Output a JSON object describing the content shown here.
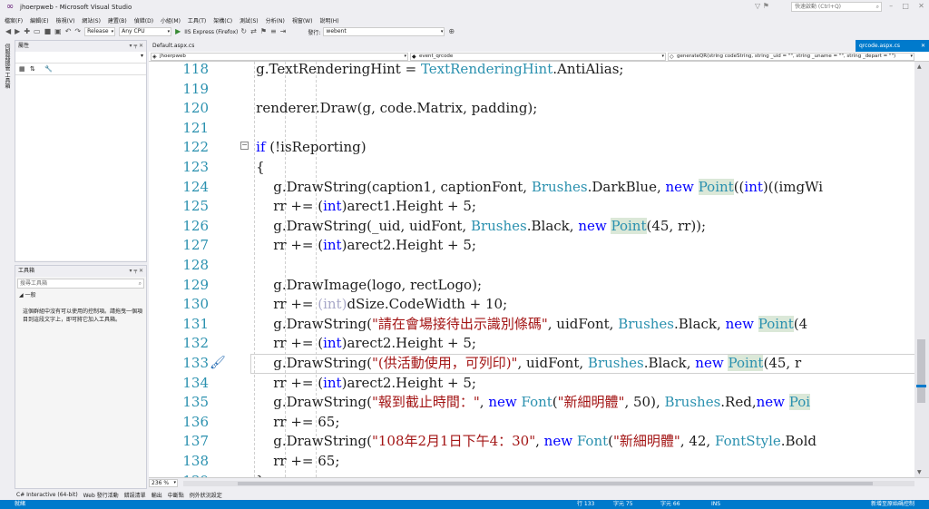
{
  "window": {
    "title": "jhoerpweb - Microsoft Visual Studio",
    "logo_icon": "visual-studio-logo-icon",
    "quick_launch_placeholder": "快速啟動 (Ctrl+Q)"
  },
  "menu": [
    "檔案(F)",
    "編輯(E)",
    "檢視(V)",
    "網站(S)",
    "建置(B)",
    "偵錯(D)",
    "小組(M)",
    "工具(T)",
    "架構(C)",
    "測試(S)",
    "分析(N)",
    "視窗(W)",
    "說明(H)"
  ],
  "toolbar": {
    "configuration": "Release",
    "platform": "Any CPU",
    "run_target": "IIS Express (Firefox)",
    "publish_label": "發行:",
    "publish_target": "webent"
  },
  "left_strip": {
    "label": "伺服器總管 工具箱"
  },
  "properties_panel": {
    "title": "屬性",
    "pin": "▾ ╤ ✕"
  },
  "toolbox_panel": {
    "title": "工具箱",
    "pin": "▾ ╤ ✕",
    "search_placeholder": "搜尋工具箱",
    "group": "◢ 一般",
    "message": "這個群組中沒有可以使用的控制項。請拖曳一個項目到這段文字上，即可將它加入工具箱。"
  },
  "tabs": {
    "left": "Default.aspx.cs",
    "active": "qrcode.aspx.cs",
    "close": "✕"
  },
  "navbar": {
    "project": "jhoerpweb",
    "class": "event_qrcode",
    "member": "generateQR(string codeString, string _uid = \"\", string _uname = \"\", string _depart = \"\")"
  },
  "editor": {
    "zoom": "236 %"
  },
  "code_lines": [
    {
      "n": "118",
      "parts": [
        {
          "t": "        g.TextRenderingHint = ",
          "c": ""
        },
        {
          "t": "TextRenderingHint",
          "c": "ty"
        },
        {
          "t": ".AntiAlias;",
          "c": ""
        }
      ]
    },
    {
      "n": "119",
      "parts": []
    },
    {
      "n": "120",
      "parts": [
        {
          "t": "        renderer.Draw(g, code.Matrix, padding);",
          "c": ""
        }
      ]
    },
    {
      "n": "121",
      "parts": []
    },
    {
      "n": "122",
      "parts": [
        {
          "t": "        ",
          "c": ""
        },
        {
          "t": "if",
          "c": "kw"
        },
        {
          "t": " (!isReporting)",
          "c": ""
        }
      ]
    },
    {
      "n": "123",
      "parts": [
        {
          "t": "        {",
          "c": ""
        }
      ]
    },
    {
      "n": "124",
      "parts": [
        {
          "t": "            g.DrawString(caption1, captionFont, ",
          "c": ""
        },
        {
          "t": "Brushes",
          "c": "ty"
        },
        {
          "t": ".DarkBlue, ",
          "c": ""
        },
        {
          "t": "new",
          "c": "kw"
        },
        {
          "t": " ",
          "c": ""
        },
        {
          "t": "Point",
          "c": "ty hl"
        },
        {
          "t": "((",
          "c": ""
        },
        {
          "t": "int",
          "c": "kw"
        },
        {
          "t": ")((imgWi",
          "c": ""
        }
      ]
    },
    {
      "n": "125",
      "parts": [
        {
          "t": "            rr += (",
          "c": ""
        },
        {
          "t": "int",
          "c": "kw"
        },
        {
          "t": ")arect1.Height + 5;",
          "c": ""
        }
      ]
    },
    {
      "n": "126",
      "parts": [
        {
          "t": "            g.DrawString(_uid, uidFont, ",
          "c": ""
        },
        {
          "t": "Brushes",
          "c": "ty"
        },
        {
          "t": ".Black, ",
          "c": ""
        },
        {
          "t": "new",
          "c": "kw"
        },
        {
          "t": " ",
          "c": ""
        },
        {
          "t": "Point",
          "c": "ty hl"
        },
        {
          "t": "(45, rr));",
          "c": ""
        }
      ]
    },
    {
      "n": "127",
      "parts": [
        {
          "t": "            rr += (",
          "c": ""
        },
        {
          "t": "int",
          "c": "kw"
        },
        {
          "t": ")arect2.Height + 5;",
          "c": ""
        }
      ]
    },
    {
      "n": "128",
      "parts": []
    },
    {
      "n": "129",
      "parts": [
        {
          "t": "            g.DrawImage(logo, rectLogo);",
          "c": ""
        }
      ]
    },
    {
      "n": "130",
      "parts": [
        {
          "t": "            rr += ",
          "c": ""
        },
        {
          "t": "(int)",
          "c": "gr"
        },
        {
          "t": "dSize.CodeWidth + 10;",
          "c": ""
        }
      ]
    },
    {
      "n": "131",
      "parts": [
        {
          "t": "            g.DrawString(",
          "c": ""
        },
        {
          "t": "\"請在會場接待出示識別條碼\"",
          "c": "st"
        },
        {
          "t": ", uidFont, ",
          "c": ""
        },
        {
          "t": "Brushes",
          "c": "ty"
        },
        {
          "t": ".Black, ",
          "c": ""
        },
        {
          "t": "new",
          "c": "kw"
        },
        {
          "t": " ",
          "c": ""
        },
        {
          "t": "Point",
          "c": "ty hl"
        },
        {
          "t": "(4",
          "c": ""
        }
      ]
    },
    {
      "n": "132",
      "parts": [
        {
          "t": "            rr += (",
          "c": ""
        },
        {
          "t": "int",
          "c": "kw"
        },
        {
          "t": ")arect2.Height + 5;",
          "c": ""
        }
      ]
    },
    {
      "n": "133",
      "parts": [
        {
          "t": "            g.DrawString(",
          "c": ""
        },
        {
          "t": "\"(供活動使用，可列印)\"",
          "c": "st"
        },
        {
          "t": ", uidFont, ",
          "c": ""
        },
        {
          "t": "Brushes",
          "c": "ty"
        },
        {
          "t": ".Black, ",
          "c": ""
        },
        {
          "t": "new",
          "c": "kw"
        },
        {
          "t": " ",
          "c": ""
        },
        {
          "t": "Point",
          "c": "ty hl"
        },
        {
          "t": "(45, r",
          "c": ""
        }
      ]
    },
    {
      "n": "134",
      "parts": [
        {
          "t": "            rr += (",
          "c": ""
        },
        {
          "t": "int",
          "c": "kw"
        },
        {
          "t": ")arect2.Height + 5;",
          "c": ""
        }
      ]
    },
    {
      "n": "135",
      "parts": [
        {
          "t": "            g.DrawString(",
          "c": ""
        },
        {
          "t": "\"報到截止時間：\"",
          "c": "st"
        },
        {
          "t": ", ",
          "c": ""
        },
        {
          "t": "new",
          "c": "kw"
        },
        {
          "t": " ",
          "c": ""
        },
        {
          "t": "Font",
          "c": "ty"
        },
        {
          "t": "(",
          "c": ""
        },
        {
          "t": "\"新細明體\"",
          "c": "st"
        },
        {
          "t": ", 50), ",
          "c": ""
        },
        {
          "t": "Brushes",
          "c": "ty"
        },
        {
          "t": ".Red,",
          "c": ""
        },
        {
          "t": "new",
          "c": "kw"
        },
        {
          "t": " ",
          "c": ""
        },
        {
          "t": "Poi",
          "c": "ty hl"
        }
      ]
    },
    {
      "n": "136",
      "parts": [
        {
          "t": "            rr += 65;",
          "c": ""
        }
      ]
    },
    {
      "n": "137",
      "parts": [
        {
          "t": "            g.DrawString(",
          "c": ""
        },
        {
          "t": "\"108年2月1日下午4：30\"",
          "c": "st"
        },
        {
          "t": ", ",
          "c": ""
        },
        {
          "t": "new",
          "c": "kw"
        },
        {
          "t": " ",
          "c": ""
        },
        {
          "t": "Font",
          "c": "ty"
        },
        {
          "t": "(",
          "c": ""
        },
        {
          "t": "\"新細明體\"",
          "c": "st"
        },
        {
          "t": ", 42, ",
          "c": ""
        },
        {
          "t": "FontStyle",
          "c": "ty"
        },
        {
          "t": ".Bold",
          "c": ""
        }
      ]
    },
    {
      "n": "138",
      "parts": [
        {
          "t": "            rr += 65;",
          "c": ""
        }
      ]
    },
    {
      "n": "139",
      "parts": [
        {
          "t": "        }",
          "c": ""
        }
      ]
    }
  ],
  "bottom_tabs": [
    "C# Interactive (64-bit)",
    "Web 發行活動",
    "錯誤清單",
    "輸出",
    "中斷點",
    "例外狀況設定"
  ],
  "status": {
    "left": "就緒",
    "line": "行 133",
    "col": "字元 75",
    "ch": "字元 66",
    "ins": "INS",
    "right": "新增至原始碼控制"
  },
  "colors": {
    "accent": "#007acc",
    "keyword": "#0000ff",
    "type": "#2b91af",
    "string": "#a31515"
  }
}
